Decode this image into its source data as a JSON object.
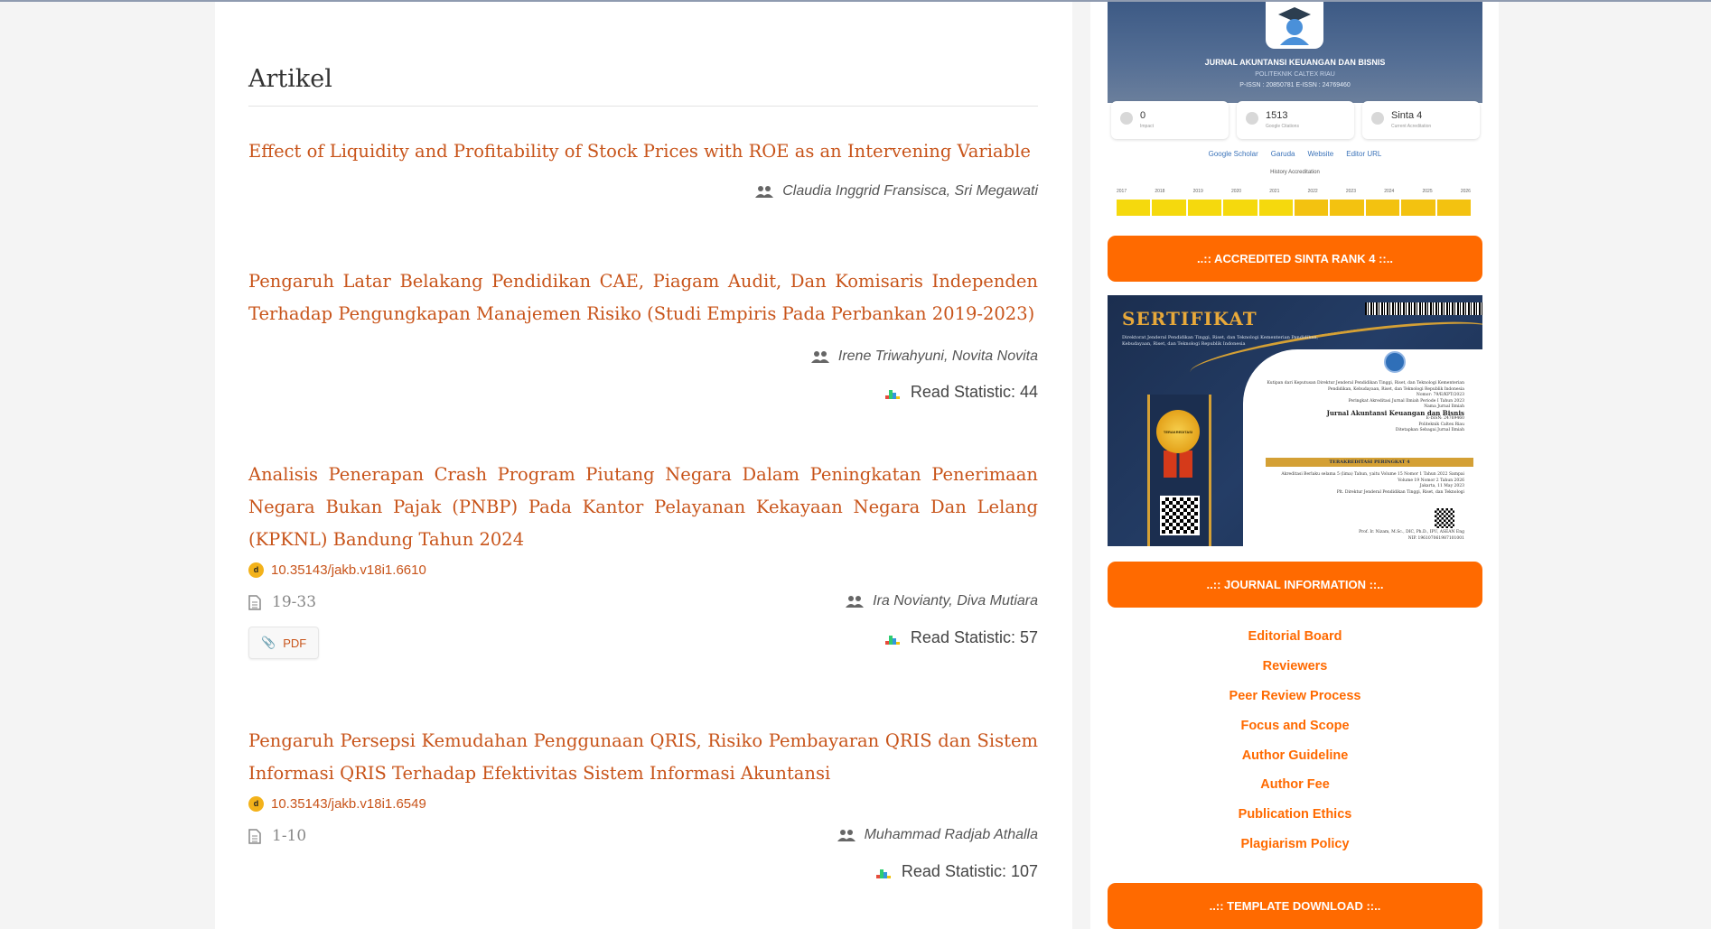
{
  "section": {
    "title": "Artikel"
  },
  "articles": [
    {
      "title": "Effect of Liquidity and Profitability of Stock Prices with ROE as an Intervening Variable",
      "authors": "Claudia Inggrid Fransisca, Sri Megawati"
    },
    {
      "title": "Pengaruh Latar Belakang Pendidikan CAE, Piagam Audit, Dan Komisaris Independen Terhadap Pengungkapan Manajemen Risiko (Studi Empiris Pada Perbankan 2019-2023)",
      "authors": "Irene Triwahyuni, Novita Novita",
      "read_statistic": "Read Statistic: 44"
    },
    {
      "title": "Analisis Penerapan Crash Program Piutang Negara Dalam Peningkatan Penerimaan Negara Bukan Pajak (PNBP) Pada Kantor Pelayanan Kekayaan Negara Dan Lelang (KPKNL) Bandung Tahun 2024",
      "doi": "10.35143/jakb.v18i1.6610",
      "pages": "19-33",
      "authors": "Ira Novianty, Diva Mutiara",
      "pdf_label": "PDF",
      "read_statistic": "Read Statistic: 57"
    },
    {
      "title": "Pengaruh Persepsi Kemudahan Penggunaan QRIS, Risiko Pembayaran QRIS dan Sistem Informasi QRIS Terhadap Efektivitas Sistem Informasi Akuntansi",
      "doi": "10.35143/jakb.v18i1.6549",
      "pages": "1-10",
      "authors": "Muhammad Radjab Athalla",
      "read_statistic": "Read Statistic: 107"
    }
  ],
  "sidebar": {
    "banner": {
      "journal_name": "JURNAL AKUNTANSI KEUANGAN DAN BISNIS",
      "institution": "POLITEKNIK CALTEX RIAU",
      "issn": "P-ISSN : 20850781  E-ISSN : 24769460",
      "stats": [
        {
          "value": "0",
          "label": "Impact"
        },
        {
          "value": "1513",
          "label": "Google Citations"
        },
        {
          "value": "Sinta 4",
          "label": "Current Acreditation"
        }
      ],
      "links": [
        "Google Scholar",
        "Garuda",
        "Website",
        "Editor URL"
      ],
      "history_label": "History Accreditation",
      "years": [
        "2017",
        "2018",
        "2019",
        "2020",
        "2021",
        "2022",
        "2023",
        "2024",
        "2025",
        "2026"
      ]
    },
    "accredited_button": "..:: ACCREDITED SINTA RANK 4 ::..",
    "certificate": {
      "title": "SERTIFIKAT",
      "org": "Direktorat Jenderal Pendidikan Tinggi, Riset, dan Teknologi Kementerian Pendidikan, Kebudayaan, Riset, dan Teknologi Republik Indonesia",
      "decree": "Kutipan dari Keputusan Direktur Jenderal Pendidikan Tinggi, Riset, dan Teknologi Kementerian Pendidikan, Kebudayaan, Riset, dan Teknologi Republik Indonesia",
      "number": "Nomor: 79/E/KPT/2023",
      "period": "Peringkat Akreditasi Jurnal Ilmiah Periode I Tahun 2023",
      "name_label": "Nama Jurnal Ilmiah",
      "journal": "Jurnal Akuntansi Keuangan dan Bisnis",
      "eissn": "E-ISSN: 24769460",
      "publisher": "Politeknik Caltex Riau",
      "as": "Ditetapkan Sebagai Jurnal Ilmiah",
      "rank": "TERAKREDITASI PERINGKAT 4",
      "medal": "TERAKREDITASI",
      "validity": "Akreditasi Berlaku selama 5 (lima) Tahun, yaitu Volume 15 Nomor 1 Tahun 2022 Sampai Volume 19 Nomor 2 Tahun 2026",
      "place_date": "Jakarta, 11 May 2023",
      "signer_title": "Plt. Direktur Jenderal Pendidikan Tinggi, Riset, dan Teknologi",
      "signer": "Prof. Ir. Nizam, M.Sc., DIC, Ph.D., IPU, ASEAN Eng",
      "nip": "NIP. 196107061987101001"
    },
    "journal_info_button": "..:: JOURNAL INFORMATION ::..",
    "info_links": [
      "Editorial Board",
      "Reviewers",
      "Peer Review Process",
      "Focus and Scope",
      "Author Guideline",
      "Author Fee",
      "Publication Ethics",
      "Plagiarism Policy"
    ],
    "template_button": "..:: TEMPLATE DOWNLOAD ::.."
  },
  "colors": {
    "link": "#c8541a",
    "accent": "#ff6a00",
    "history_bar": "#f5d90d"
  }
}
